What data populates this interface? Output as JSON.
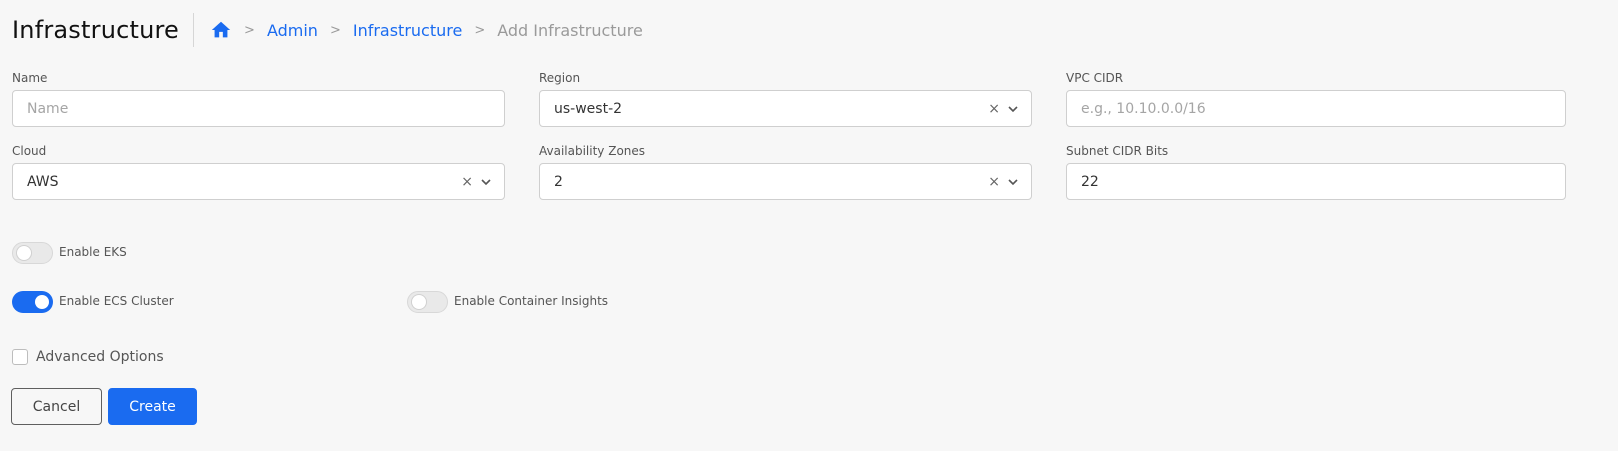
{
  "header": {
    "title": "Infrastructure",
    "breadcrumb": {
      "home_icon": "home-icon",
      "items": [
        "Admin",
        "Infrastructure",
        "Add Infrastructure"
      ],
      "separator": ">"
    }
  },
  "form": {
    "name": {
      "label": "Name",
      "value": "",
      "placeholder": "Name"
    },
    "region": {
      "label": "Region",
      "value": "us-west-2"
    },
    "vpc_cidr": {
      "label": "VPC CIDR",
      "value": "",
      "placeholder": "e.g., 10.10.0.0/16"
    },
    "cloud": {
      "label": "Cloud",
      "value": "AWS"
    },
    "availability_zones": {
      "label": "Availability Zones",
      "value": "2"
    },
    "subnet_cidr_bits": {
      "label": "Subnet CIDR Bits",
      "value": "22"
    },
    "clear_glyph": "×"
  },
  "toggles": {
    "enable_eks": {
      "label": "Enable EKS",
      "on": false
    },
    "enable_ecs_cluster": {
      "label": "Enable ECS Cluster",
      "on": true
    },
    "enable_container_insights": {
      "label": "Enable Container Insights",
      "on": false
    }
  },
  "advanced_options": {
    "label": "Advanced Options",
    "checked": false
  },
  "actions": {
    "cancel_label": "Cancel",
    "create_label": "Create"
  },
  "colors": {
    "accent": "#1a6bf0",
    "background": "#f7f7f7",
    "muted": "#9a9a9a"
  }
}
